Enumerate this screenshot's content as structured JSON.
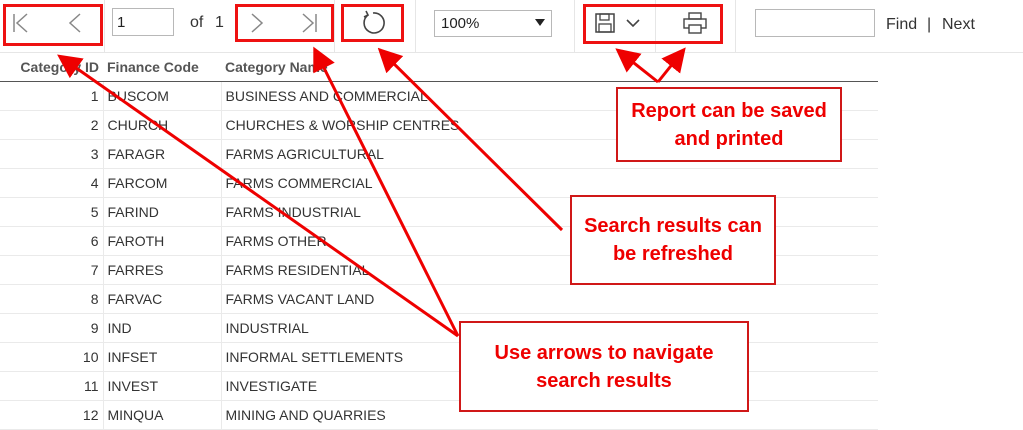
{
  "toolbar": {
    "page_value": "1",
    "of_label": "of",
    "total_pages": "1",
    "zoom_value": "100%",
    "find_label": "Find",
    "separator": "|",
    "next_label": "Next",
    "icons": {
      "first": "first-page-icon",
      "prev": "previous-page-icon",
      "next": "next-page-icon",
      "last": "last-page-icon",
      "refresh": "refresh-icon",
      "save": "save-icon",
      "print": "print-icon"
    }
  },
  "table": {
    "headers": [
      "Category ID",
      "Finance Code",
      "Category Name"
    ],
    "rows": [
      [
        "1",
        "BUSCOM",
        "BUSINESS AND COMMERCIAL"
      ],
      [
        "2",
        "CHURCH",
        "CHURCHES & WORSHIP CENTRES"
      ],
      [
        "3",
        "FARAGR",
        "FARMS AGRICULTURAL"
      ],
      [
        "4",
        "FARCOM",
        "FARMS COMMERCIAL"
      ],
      [
        "5",
        "FARIND",
        "FARMS INDUSTRIAL"
      ],
      [
        "6",
        "FAROTH",
        "FARMS OTHER"
      ],
      [
        "7",
        "FARRES",
        "FARMS RESIDENTIAL"
      ],
      [
        "8",
        "FARVAC",
        "FARMS VACANT LAND"
      ],
      [
        "9",
        "IND",
        "INDUSTRIAL"
      ],
      [
        "10",
        "INFSET",
        "INFORMAL SETTLEMENTS"
      ],
      [
        "11",
        "INVEST",
        "INVESTIGATE"
      ],
      [
        "12",
        "MINQUA",
        "MINING AND QUARRIES"
      ]
    ]
  },
  "annotations": {
    "save_print": "Report can be saved and printed",
    "refresh": "Search results can be refreshed",
    "navigate": "Use arrows to navigate search results",
    "color": "#e00000"
  }
}
